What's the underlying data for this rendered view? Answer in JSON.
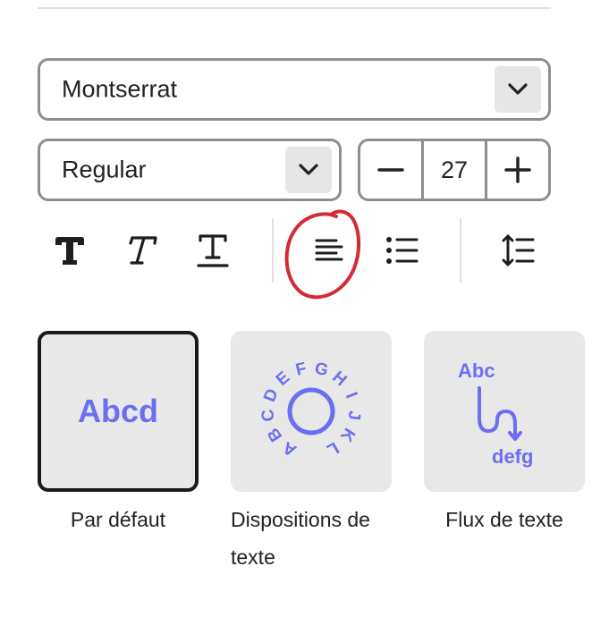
{
  "font_family": {
    "value": "Montserrat",
    "icon": "chevron-down-icon"
  },
  "font_style": {
    "value": "Regular",
    "icon": "chevron-down-icon"
  },
  "font_size": {
    "value": "27",
    "decrement_icon": "minus-icon",
    "increment_icon": "plus-icon"
  },
  "toolbar": {
    "bold_icon": "bold-icon",
    "italic_icon": "italic-icon",
    "underline_icon": "underline-icon",
    "align_icon": "align-left-icon",
    "list_icon": "bullet-list-icon",
    "spacing_icon": "line-spacing-icon"
  },
  "text_styles": [
    {
      "preview": "Abcd",
      "caption": "Par défaut",
      "selected": true
    },
    {
      "preview": "ABCDEFGHIJKL",
      "caption_line1": "Dispositions de",
      "caption_line2": "texte"
    },
    {
      "preview_top": "Abc",
      "preview_bottom": "defg",
      "caption": "Flux de texte"
    }
  ],
  "colors": {
    "accent": "#6b6ff0",
    "annotation": "#d42a35",
    "border": "#8e8e8e"
  }
}
